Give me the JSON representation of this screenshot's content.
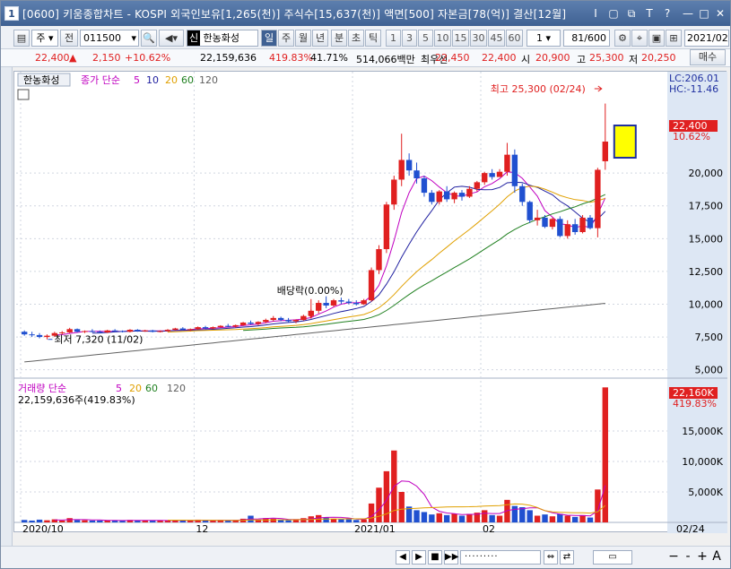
{
  "window": {
    "app_icon_label": "1",
    "title": "[0600] 키움종합차트 - KOSPI 외국인보유[1,265(천)] 주식수[15,637(천)] 액면[500] 자본금[78(억)] 결산[12월]",
    "buttons": [
      "I",
      "▢",
      "⧉",
      "T",
      "?",
      "—",
      "□",
      "✕"
    ]
  },
  "toolbar": {
    "market": "주",
    "prev_label": "전",
    "code": "011500",
    "stock_badge": "신",
    "stock_name": "한농화성",
    "periods": [
      "일",
      "주",
      "월",
      "년",
      "분",
      "초",
      "틱"
    ],
    "active_period": "일",
    "intervals": [
      "1",
      "3",
      "5",
      "10",
      "15",
      "30",
      "45",
      "60"
    ],
    "interval_select": "1",
    "page": "81/600",
    "date": "2021/02/",
    "buy_label": "매수"
  },
  "quote": {
    "price": "22,400",
    "arrow": "▲",
    "change": "2,150",
    "change_pct": "+10.62%",
    "volume": "22,159,636",
    "volume_pct": "419.83%",
    "turnover_pct": "41.71%",
    "amount": "514,066백만",
    "best_ask_label": "최우선",
    "best_ask": "22,450",
    "best_bid": "22,400",
    "open_label": "시",
    "open": "20,900",
    "high_label": "고",
    "high": "25,300",
    "low_label": "저",
    "low": "20,250"
  },
  "price_panel": {
    "stock_label": "한농화성",
    "legend_prefix": "종가 단순",
    "ma_periods": [
      "5",
      "10",
      "20",
      "60",
      "120"
    ],
    "ma_colors": [
      "#c000c0",
      "#2020a0",
      "#e0a000",
      "#208020",
      "#606060"
    ],
    "lc_label": "LC:206.01",
    "hc_label": "HC:-11.46",
    "current_price_tag": "22,400",
    "current_pct_tag": "10.62%",
    "y_ticks": [
      "20,000",
      "17,500",
      "15,000",
      "12,500",
      "10,000",
      "7,500",
      "5,000"
    ],
    "high_annotation": "최고 25,300 (02/24)",
    "low_annotation": "최저 7,320 (11/02)",
    "dividend_annotation": "배당락(0.00%)"
  },
  "volume_panel": {
    "legend_prefix": "거래량 단순",
    "ma_periods": [
      "5",
      "20",
      "60",
      "120"
    ],
    "ma_colors": [
      "#c000c0",
      "#e0a000",
      "#208020",
      "#606060"
    ],
    "volume_text": "22,159,636주(419.83%)",
    "current_volume_tag": "22,160K",
    "current_pct_tag": "419.83%",
    "y_ticks": [
      "15,000K",
      "10,000K",
      "5,000K"
    ]
  },
  "x_axis": {
    "labels": [
      "2020/10",
      "12",
      "2021/01",
      "02"
    ],
    "end_label": "02/24"
  },
  "colors": {
    "up": "#e02020",
    "down": "#2050d0",
    "title_bg": "#3f6193",
    "axis_bg": "#dde7f4"
  },
  "chart_data": {
    "type": "candlestick",
    "ylim": [
      4500,
      26500
    ],
    "volume_ylim": [
      0,
      22500
    ],
    "candles": [
      [
        7900,
        8000,
        7600,
        7700
      ],
      [
        7700,
        7900,
        7500,
        7650
      ],
      [
        7650,
        7800,
        7400,
        7500
      ],
      [
        7500,
        7700,
        7320,
        7600
      ],
      [
        7600,
        7900,
        7500,
        7800
      ],
      [
        7800,
        7950,
        7700,
        7850
      ],
      [
        7850,
        8200,
        7800,
        8100
      ],
      [
        8100,
        8150,
        7850,
        7900
      ],
      [
        7900,
        8000,
        7800,
        7950
      ],
      [
        7950,
        8100,
        7850,
        7900
      ],
      [
        7900,
        8000,
        7800,
        7850
      ],
      [
        7850,
        8050,
        7800,
        8000
      ],
      [
        8000,
        8100,
        7900,
        7950
      ],
      [
        7950,
        8000,
        7850,
        7900
      ],
      [
        7900,
        8100,
        7850,
        8050
      ],
      [
        8050,
        8100,
        7900,
        7950
      ],
      [
        7950,
        8050,
        7900,
        8000
      ],
      [
        8000,
        8050,
        7850,
        7900
      ],
      [
        7900,
        8000,
        7850,
        7950
      ],
      [
        7950,
        8100,
        7900,
        8050
      ],
      [
        8050,
        8200,
        8000,
        8150
      ],
      [
        8150,
        8250,
        8000,
        8050
      ],
      [
        8050,
        8150,
        7950,
        8100
      ],
      [
        8100,
        8300,
        8050,
        8250
      ],
      [
        8250,
        8350,
        8100,
        8150
      ],
      [
        8150,
        8300,
        8100,
        8250
      ],
      [
        8250,
        8400,
        8200,
        8350
      ],
      [
        8350,
        8500,
        8250,
        8300
      ],
      [
        8300,
        8450,
        8200,
        8400
      ],
      [
        8400,
        8650,
        8350,
        8600
      ],
      [
        8600,
        8750,
        8450,
        8500
      ],
      [
        8500,
        8700,
        8400,
        8650
      ],
      [
        8650,
        8900,
        8550,
        8800
      ],
      [
        8800,
        9100,
        8700,
        8950
      ],
      [
        8950,
        9050,
        8700,
        8800
      ],
      [
        8800,
        8950,
        8600,
        8700
      ],
      [
        8700,
        8850,
        8550,
        8800
      ],
      [
        8800,
        9200,
        8750,
        9100
      ],
      [
        9100,
        9600,
        8900,
        9500
      ],
      [
        9500,
        10300,
        9300,
        10100
      ],
      [
        10100,
        10600,
        9700,
        9900
      ],
      [
        9900,
        10400,
        9800,
        10300
      ],
      [
        10300,
        10500,
        10000,
        10200
      ],
      [
        10200,
        10400,
        10000,
        10100
      ],
      [
        10100,
        10300,
        9900,
        10000
      ],
      [
        10000,
        10400,
        9950,
        10300
      ],
      [
        10300,
        12800,
        10200,
        12600
      ],
      [
        12600,
        14500,
        12300,
        14200
      ],
      [
        14200,
        17800,
        13900,
        17600
      ],
      [
        17600,
        19800,
        17200,
        19500
      ],
      [
        19500,
        23000,
        19000,
        21000
      ],
      [
        21000,
        21500,
        19800,
        20200
      ],
      [
        20200,
        20800,
        19200,
        19600
      ],
      [
        19600,
        19800,
        18200,
        18500
      ],
      [
        18500,
        18700,
        17600,
        17800
      ],
      [
        17800,
        18700,
        17600,
        18600
      ],
      [
        18600,
        19000,
        17800,
        18000
      ],
      [
        18000,
        18600,
        17700,
        18500
      ],
      [
        18500,
        18700,
        17900,
        18200
      ],
      [
        18200,
        19000,
        18100,
        18800
      ],
      [
        18800,
        19400,
        18600,
        19300
      ],
      [
        19300,
        20100,
        19100,
        20000
      ],
      [
        20000,
        20300,
        19500,
        19700
      ],
      [
        19700,
        20300,
        19700,
        20100
      ],
      [
        20100,
        22300,
        19800,
        21400
      ],
      [
        21400,
        21800,
        18500,
        19000
      ],
      [
        19000,
        19200,
        17500,
        17800
      ],
      [
        17800,
        17900,
        16200,
        16400
      ],
      [
        16400,
        17200,
        16000,
        16600
      ],
      [
        16600,
        16800,
        15800,
        15900
      ],
      [
        15900,
        16600,
        15700,
        16500
      ],
      [
        16500,
        16700,
        15100,
        15200
      ],
      [
        15200,
        16400,
        15000,
        16100
      ],
      [
        16100,
        16500,
        15300,
        15500
      ],
      [
        15500,
        16800,
        15400,
        16600
      ],
      [
        16600,
        16800,
        15700,
        15800
      ],
      [
        15800,
        20400,
        15100,
        20250
      ],
      [
        20900,
        25300,
        20250,
        22400
      ]
    ],
    "volume": [
      400,
      300,
      450,
      350,
      500,
      300,
      700,
      400,
      350,
      300,
      300,
      350,
      300,
      300,
      400,
      300,
      300,
      300,
      300,
      350,
      400,
      300,
      300,
      450,
      300,
      350,
      400,
      300,
      400,
      600,
      1100,
      450,
      700,
      600,
      400,
      350,
      400,
      700,
      1000,
      1200,
      800,
      600,
      500,
      500,
      400,
      500,
      3100,
      5700,
      8400,
      11800,
      5000,
      2600,
      2000,
      1700,
      1300,
      1500,
      1200,
      1400,
      1100,
      1400,
      1600,
      2000,
      1200,
      1100,
      3700,
      2700,
      2500,
      2000,
      1100,
      1300,
      1000,
      1400,
      1100,
      900,
      1200,
      800,
      5400,
      22160
    ]
  }
}
